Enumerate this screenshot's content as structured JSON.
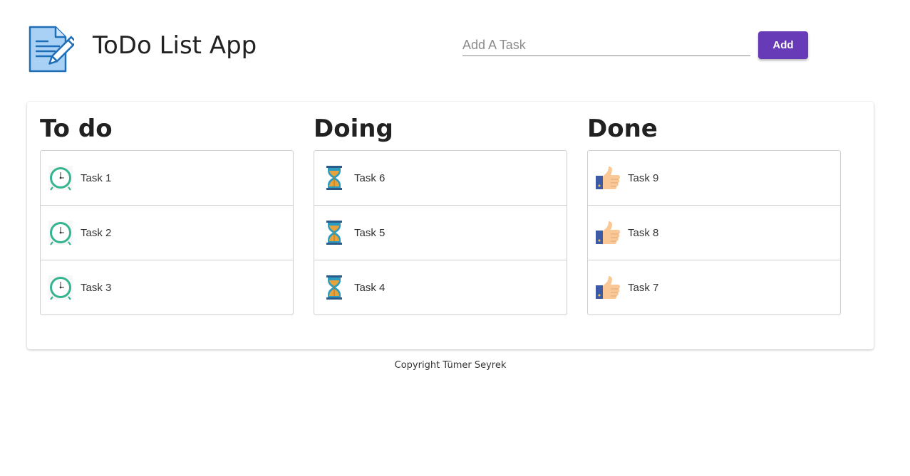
{
  "header": {
    "title": "ToDo List App",
    "input_placeholder": "Add A Task",
    "input_value": "",
    "add_label": "Add",
    "accent_color": "#673ab7",
    "logo_icon": "document-pencil-icon"
  },
  "columns": [
    {
      "title": "To do",
      "icon": "alarm-clock-icon",
      "tasks": [
        {
          "label": "Task 1"
        },
        {
          "label": "Task 2"
        },
        {
          "label": "Task 3"
        }
      ]
    },
    {
      "title": "Doing",
      "icon": "hourglass-icon",
      "tasks": [
        {
          "label": "Task 6"
        },
        {
          "label": "Task 5"
        },
        {
          "label": "Task 4"
        }
      ]
    },
    {
      "title": "Done",
      "icon": "thumbs-up-icon",
      "tasks": [
        {
          "label": "Task 9"
        },
        {
          "label": "Task 8"
        },
        {
          "label": "Task 7"
        }
      ]
    }
  ],
  "footer": {
    "text": "Copyright Tümer Seyrek"
  }
}
